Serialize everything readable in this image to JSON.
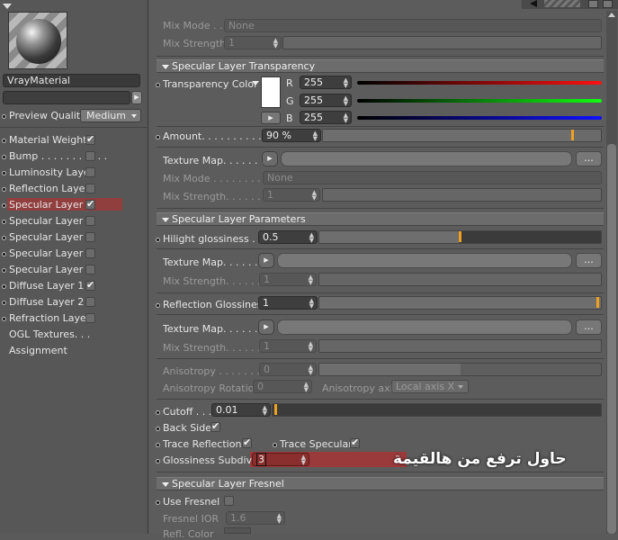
{
  "left": {
    "material_name": "VrayMaterial",
    "preview_quality_label": "Preview Quality",
    "preview_quality_value": "Medium",
    "items": [
      {
        "label": "Material Weight",
        "checked": true
      },
      {
        "label": "Bump . . . . . . . . . . .",
        "checked": false
      },
      {
        "label": "Luminosity Layer",
        "checked": false
      },
      {
        "label": "Reflection Layer",
        "checked": false
      },
      {
        "label": "Specular Layer 1",
        "checked": true
      },
      {
        "label": "Specular Layer 2",
        "checked": false
      },
      {
        "label": "Specular Layer 3",
        "checked": false
      },
      {
        "label": "Specular Layer 4",
        "checked": false
      },
      {
        "label": "Specular Layer 5",
        "checked": false
      },
      {
        "label": "Diffuse Layer 1",
        "checked": true
      },
      {
        "label": "Diffuse Layer 2",
        "checked": false
      },
      {
        "label": "Refraction Layer",
        "checked": false
      }
    ],
    "ogl_textures": "OGL Textures. . .",
    "assignment": "Assignment"
  },
  "top": {
    "mix_mode_label": "Mix Mode . .",
    "mix_mode_value": "None",
    "mix_strength_label": "Mix Strength",
    "mix_strength_value": "1"
  },
  "transparency": {
    "header": "Specular Layer Transparency",
    "color_label": "Transparency Color",
    "r_label": "R",
    "r_value": "255",
    "g_label": "G",
    "g_value": "255",
    "b_label": "B",
    "b_value": "255",
    "amount_label": "Amount. . . . . . . . . . . . .",
    "amount_value": "90 %",
    "amount_fraction": 0.9,
    "texture_label": "Texture Map. . . . . . .",
    "dots": "...",
    "mix_mode_label": "Mix Mode . . . . . . . . . .",
    "mix_mode_value": "None",
    "mix_strength_label": "Mix Strength. . . . . . . .",
    "mix_strength_value": "1"
  },
  "parameters": {
    "header": "Specular Layer Parameters",
    "hilight_label": "Hilight glossiness . . .",
    "hilight_value": "0.5",
    "hilight_fraction": 0.5,
    "texture_label": "Texture Map. . . . . . .",
    "dots": "...",
    "mix_strength_label": "Mix Strength. . . . . . .",
    "mix_strength_value": "1",
    "refl_gloss_label": "Reflection Glossiness",
    "refl_gloss_value": "1",
    "refl_gloss_fraction": 1.0,
    "texture2_label": "Texture Map. . . . . . .",
    "mix_strength2_label": "Mix Strength. . . . . . .",
    "mix_strength2_value": "1",
    "anisotropy_label": "Anisotropy . . . . . . . .",
    "anisotropy_value": "0",
    "aniso_rot_label": "Anisotropy Rotation",
    "aniso_rot_value": "0",
    "aniso_axis_label": "Anisotropy axis",
    "aniso_axis_value": "Local axis X",
    "cutoff_label": "Cutoff . . .",
    "cutoff_value": "0.01",
    "cutoff_fraction": 0.01,
    "back_side_label": "Back Side",
    "trace_refl_label": "Trace Reflections",
    "trace_spec_label": "Trace Specular",
    "gloss_subdivs_label": "Glossiness Subdivs",
    "gloss_subdivs_value": "3",
    "arabic_note": "حاول ترفع من هالقيمة"
  },
  "fresnel": {
    "header": "Specular Layer Fresnel",
    "use_label": "Use Fresnel",
    "ior_label": "Fresnel IOR",
    "ior_value": "1.6",
    "refl_color_label": "Refl. Color"
  }
}
